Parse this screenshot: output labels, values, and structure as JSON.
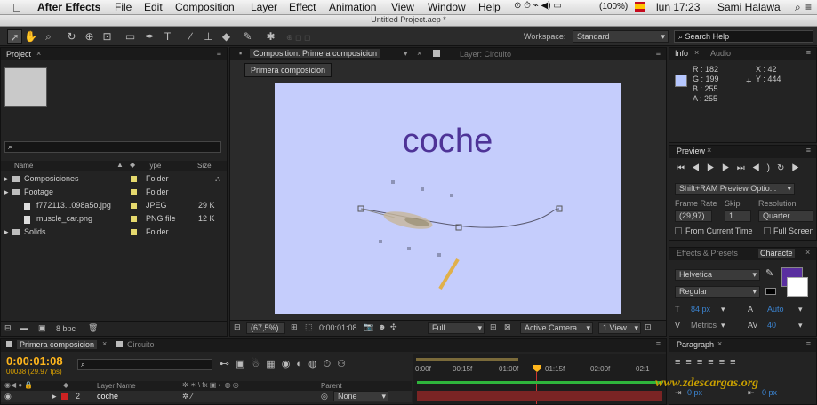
{
  "menubar": {
    "apple": "",
    "app": "After Effects",
    "items": [
      "File",
      "Edit",
      "Composition",
      "Layer",
      "Effect",
      "Animation",
      "View",
      "Window",
      "Help"
    ],
    "battery": "(100%)",
    "clock": "lun 17:23",
    "user": "Sami Halawa"
  },
  "window_title": "Untitled Project.aep *",
  "workspace": {
    "label": "Workspace:",
    "value": "Standard"
  },
  "search_help": "Search Help",
  "project": {
    "tab": "Project",
    "search": "⌕",
    "columns": {
      "name": "Name",
      "type": "Type",
      "size": "Size"
    },
    "rows": [
      {
        "name": "Composiciones",
        "type": "Folder",
        "size": "",
        "kind": "folder",
        "indent": 0
      },
      {
        "name": "Footage",
        "type": "Folder",
        "size": "",
        "kind": "folder",
        "indent": 0
      },
      {
        "name": "f772113...098a5o.jpg",
        "type": "JPEG",
        "size": "29 K",
        "kind": "file",
        "indent": 1
      },
      {
        "name": "muscle_car.png",
        "type": "PNG file",
        "size": "12 K",
        "kind": "file",
        "indent": 1
      },
      {
        "name": "Solids",
        "type": "Folder",
        "size": "",
        "kind": "folder",
        "indent": 0
      }
    ],
    "bpc": "8 bpc"
  },
  "composition": {
    "tab": "Composition: Primera composicion",
    "layer_tab": "Layer: Circuito",
    "sub_tab": "Primera composicion",
    "canvas_text": "coche",
    "bg_color": "#c5cdfc",
    "text_color": "#4e3397",
    "zoom": "(67,5%)",
    "timecode": "0:00:01:08",
    "resolution": "Full",
    "camera": "Active Camera",
    "view": "1 View"
  },
  "info": {
    "tab": "Info",
    "audio_tab": "Audio",
    "r": "R : 182",
    "g": "G : 199",
    "b": "B : 255",
    "a": "A : 255",
    "x": "X : 42",
    "y": "Y : 444"
  },
  "preview": {
    "tab": "Preview",
    "mode": "Shift+RAM Preview Optio...",
    "frame_rate_label": "Frame Rate",
    "skip_label": "Skip",
    "resolution_label": "Resolution",
    "frame_rate": "(29,97)",
    "skip": "1",
    "resolution": "Quarter",
    "from_current": "From Current Time",
    "full_screen": "Full Screen"
  },
  "effects": {
    "tab": "Effects & Presets",
    "char_tab": "Characte"
  },
  "character": {
    "font": "Helvetica",
    "style": "Regular",
    "size": "84 px",
    "leading": "Auto",
    "metrics": "Metrics",
    "tracking": "40",
    "fill_color": "#5a2fa0"
  },
  "paragraph": {
    "tab": "Paragraph",
    "indent1": "0 px",
    "indent2": "0 px"
  },
  "timeline": {
    "tab": "Primera composicion",
    "tab2": "Circuito",
    "timecode": "0:00:01:08",
    "frames": "00038 (29.97 fps)",
    "search": "⌕",
    "ruler": [
      "0:00f",
      "00:15f",
      "01:00f",
      "01:15f",
      "02:00f",
      "02:1"
    ],
    "columns": {
      "layer_name": "Layer Name",
      "parent": "Parent"
    },
    "layer": {
      "num": "2",
      "name": "coche",
      "parent": "None"
    }
  },
  "watermark": "www.zdescargas.org"
}
